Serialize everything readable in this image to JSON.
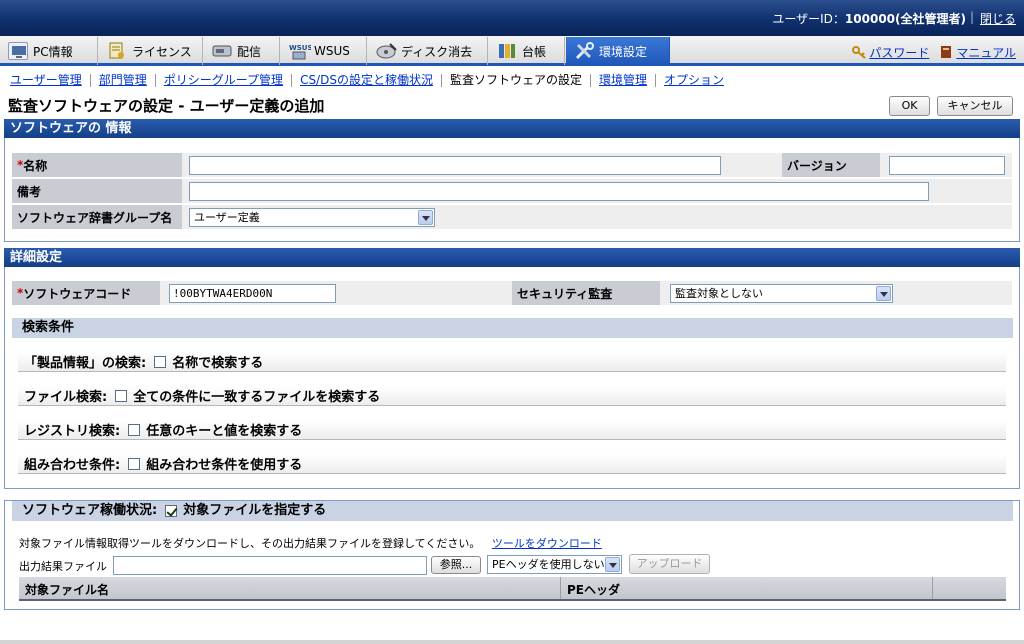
{
  "header": {
    "user_label": "ユーザーID：",
    "user_value": "100000(全社管理者)",
    "close_link": "閉じる"
  },
  "tabs": [
    {
      "label": "PC情報",
      "icon": "pc-icon",
      "color": "#4a6fa5"
    },
    {
      "label": "ライセンス",
      "icon": "license-icon",
      "color": "#b0902a"
    },
    {
      "label": "配信",
      "icon": "distribution-icon",
      "color": "#6a7c99"
    },
    {
      "label": "WSUS",
      "icon": "wsus-icon",
      "color": "#7a8aa8"
    },
    {
      "label": "ディスク消去",
      "icon": "disk-erase-icon",
      "color": "#556070"
    },
    {
      "label": "台帳",
      "icon": "ledger-icon",
      "color": "#3b6db3"
    },
    {
      "label": "環境設定",
      "icon": "settings-tools-icon",
      "color": "#d0d8e8"
    }
  ],
  "toplinks": {
    "password": "パスワード",
    "manual": "マニュアル"
  },
  "subnav": [
    {
      "label": "ユーザー管理",
      "link": true
    },
    {
      "label": "部門管理",
      "link": true
    },
    {
      "label": "ポリシーグループ管理",
      "link": true
    },
    {
      "label": "CS/DSの設定と稼働状況",
      "link": true
    },
    {
      "label": "監査ソフトウェアの設定",
      "link": false
    },
    {
      "label": "環境管理",
      "link": true
    },
    {
      "label": "オプション",
      "link": true
    }
  ],
  "page": {
    "title": "監査ソフトウェアの設定 - ユーザー定義の追加",
    "ok": "OK",
    "cancel": "キャンセル"
  },
  "software_info": {
    "heading": "ソフトウェアの 情報",
    "name_label": "名称",
    "name_value": "",
    "version_label": "バージョン",
    "version_value": "",
    "notes_label": "備考",
    "notes_value": "",
    "dict_group_label": "ソフトウェア辞書グループ名",
    "dict_group_value": "ユーザー定義"
  },
  "detail": {
    "heading": "詳細設定",
    "code_label": "ソフトウェアコード",
    "code_value": "!00BYTWA4ERD00N",
    "security_label": "セキュリティ監査",
    "security_value": "監査対象としない",
    "search_heading": "検索条件",
    "product_search_label": "「製品情報」の検索:",
    "product_search_option": "名称で検索する",
    "file_search_label": "ファイル検索:",
    "file_search_option": "全ての条件に一致するファイルを検索する",
    "registry_search_label": "レジストリ検索:",
    "registry_search_option": "任意のキーと値を検索する",
    "combo_label": "組み合わせ条件:",
    "combo_option": "組み合わせ条件を使用する",
    "operation_label": "ソフトウェア稼働状況:",
    "operation_option": "対象ファイルを指定する",
    "operation_checked": true,
    "instruction": "対象ファイル情報取得ツールをダウンロードし、その出力結果ファイルを登録してください。",
    "download_link": "ツールをダウンロード",
    "output_file_label": "出力結果ファイル",
    "output_file_value": "",
    "browse_button": "参照...",
    "pe_select": "PEヘッダを使用しない",
    "upload_button": "アップロード",
    "table_headers": [
      "対象ファイル名",
      "PEヘッダ",
      ""
    ]
  }
}
